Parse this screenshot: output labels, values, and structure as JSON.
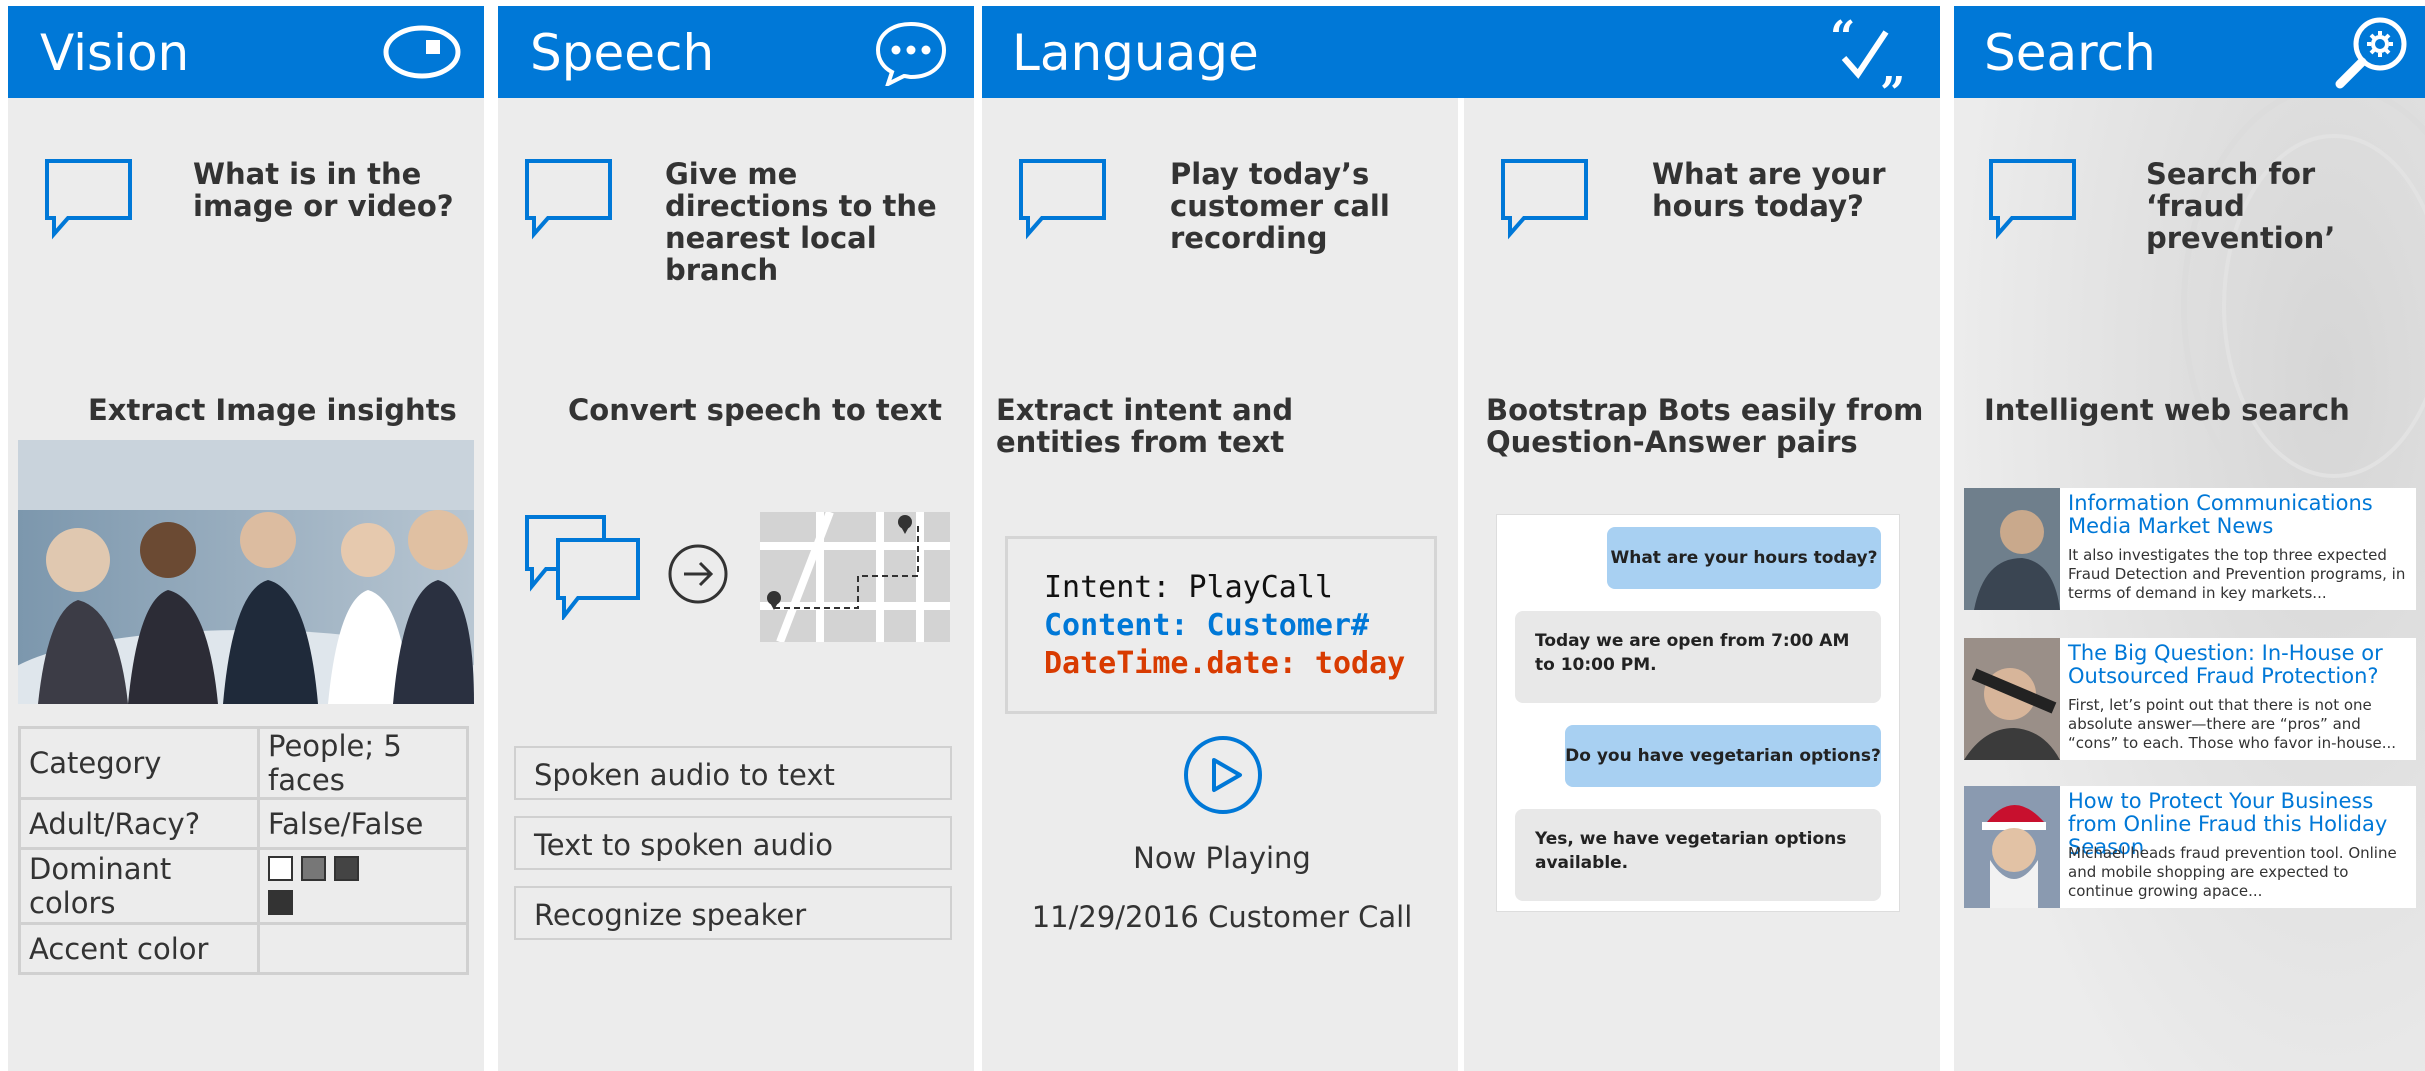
{
  "vision": {
    "title": "Vision",
    "question": "What is in the image or video?",
    "subtitle": "Extract Image insights",
    "table": [
      {
        "label": "Category",
        "value": "People; 5 faces"
      },
      {
        "label": "Adult/Racy?",
        "value": "False/False"
      },
      {
        "label": "Dominant colors",
        "value": ""
      },
      {
        "label": "Accent color",
        "value": ""
      }
    ],
    "dominant_colors": [
      "#ffffff",
      "#777777",
      "#444444",
      "#333333"
    ]
  },
  "speech": {
    "title": "Speech",
    "question": "Give me directions to the nearest local branch",
    "subtitle": "Convert speech to text",
    "items": [
      "Spoken audio to text",
      "Text to spoken audio",
      "Recognize speaker"
    ]
  },
  "language": {
    "title": "Language",
    "left": {
      "question": "Play today’s customer call recording",
      "subtitle": "Extract intent and entities from text",
      "code": {
        "intent": "Intent: PlayCall",
        "content": "Content: Customer#",
        "datetime": "DateTime.date: today"
      },
      "now_playing": "Now Playing",
      "call": "11/29/2016 Customer Call"
    },
    "right": {
      "question": "What are your hours today?",
      "subtitle": "Bootstrap Bots easily from Question-Answer pairs",
      "chat": [
        "What are your hours today?",
        "Today we are open from 7:00 AM to 10:00 PM.",
        "Do you have vegetarian options?",
        "Yes, we have vegetarian options available."
      ]
    }
  },
  "search": {
    "title": "Search",
    "question": "Search for ‘fraud prevention’",
    "subtitle": "Intelligent web search",
    "results": [
      {
        "title": "Information Communications Media Market News",
        "desc": "It also investigates the top three expected Fraud Detection and Prevention programs, in terms of demand in key markets..."
      },
      {
        "title": "The Big Question: In-House or Outsourced Fraud Protection?",
        "desc": "First, let’s point out that there is not one absolute answer—there are “pros” and “cons” to each. Those who favor in-house..."
      },
      {
        "title": "How to Protect Your Business from Online Fraud this Holiday Season",
        "desc": "Michael heads fraud prevention tool. Online and mobile shopping are expected to continue growing apace..."
      }
    ]
  },
  "colors": {
    "accent": "#0078d7",
    "panel": "#ececec",
    "intent_content": "#0078d7",
    "intent_datetime": "#d83b01"
  }
}
